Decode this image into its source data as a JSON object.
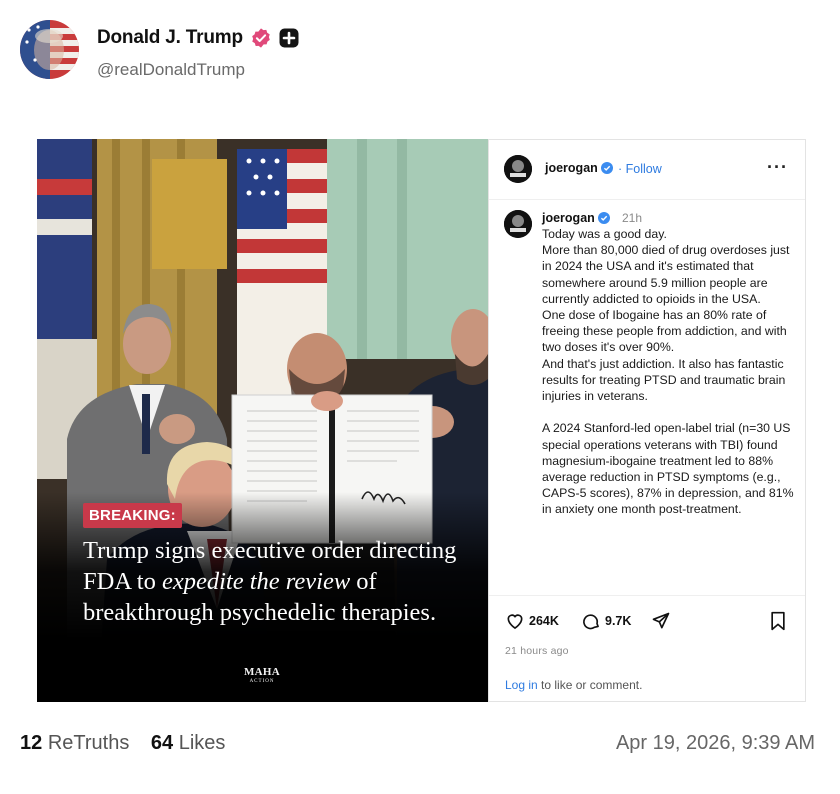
{
  "author": {
    "display_name": "Donald J. Trump",
    "handle": "@realDonaldTrump",
    "avatar_icon": "flag-portrait-avatar",
    "verified_icon": "verified-badge-icon",
    "verified_color": "#e0497a",
    "extra_icon": "plus-badge-icon"
  },
  "embed": {
    "breaking_label": "BREAKING:",
    "headline": {
      "part1": "Trump signs executive order directing FDA to ",
      "italic1": "expedite the review",
      "part2": " of breakthrough psychedelic therapies."
    },
    "brand_mark": "MAHA",
    "brand_sub": "ACTION",
    "breaking_color": "#c8394a",
    "instagram": {
      "header_user": "joerogan",
      "follow_label": "Follow",
      "separator": "·",
      "more_icon": "more-dots-icon",
      "caption_user": "joerogan",
      "caption_time": "21h",
      "caption": "Today was a good day.\nMore than 80,000 died of drug overdoses just in 2024 the USA and it's estimated that somewhere around 5.9 million people are currently addicted to opioids in the USA.\nOne dose of Ibogaine has an 80% rate of freeing these people from addiction, and with two doses it's over 90%.\nAnd that's just addiction.  It also has fantastic results for treating PTSD and traumatic brain injuries in veterans.\n\nA 2024 Stanford-led open-label trial (n=30 US special operations veterans with TBI) found magnesium-ibogaine treatment led to 88% average reduction in PTSD symptoms (e.g., CAPS-5 scores), 87% in depression, and 81% in anxiety one month post-treatment.",
      "likes": "264K",
      "comments": "9.7K",
      "time_ago": "21 hours ago",
      "login_link": "Log in",
      "login_rest": " to like or comment.",
      "link_color": "#2e7be0"
    }
  },
  "stats": {
    "retruths_count": "12",
    "retruths_label": "ReTruths",
    "likes_count": "64",
    "likes_label": "Likes"
  },
  "timestamp": "Apr 19, 2026, 9:39 AM"
}
